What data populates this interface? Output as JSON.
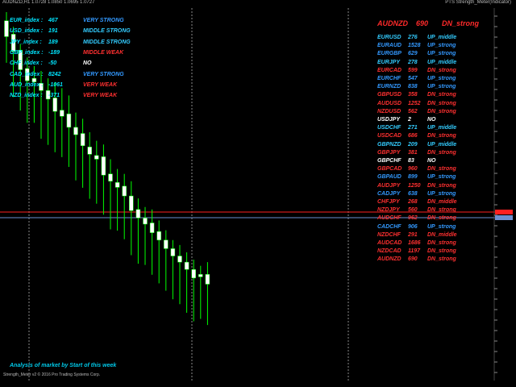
{
  "window": {
    "title": "AUDNZD,H1  1.0728 1.0850 1.0695 1.0727",
    "indicator_title": "PTS Strength_Meter(Indicator)"
  },
  "colors": {
    "bull": "#ffffff",
    "bear": "#ffffff",
    "wick": "#00ff00",
    "grid": "#666666",
    "strong_up": "#3399ff",
    "middle_up": "#33ccff",
    "weak": "#ff3030",
    "neutral": "#ffffff",
    "index_name": "#00e5ff",
    "price_line_red": "#ff2020",
    "price_line_blue": "#6d8fd0"
  },
  "indices": [
    {
      "name": "EUR_index :",
      "value": "467",
      "status": "VERY STRONG",
      "tone": "strong"
    },
    {
      "name": "USD_index :",
      "value": "191",
      "status": "MIDDLE STRONG",
      "tone": "middle"
    },
    {
      "name": "JPY_index :",
      "value": "189",
      "status": "MIDDLE STRONG",
      "tone": "middle"
    },
    {
      "name": "GBP_index :",
      "value": "-189",
      "status": "MIDDLE WEAK",
      "tone": "weak"
    },
    {
      "name": "CHF_index :",
      "value": "-50",
      "status": "NO",
      "tone": "neutral"
    },
    {
      "name": "CAD_index :",
      "value": "8242",
      "status": "VERY STRONG",
      "tone": "strong"
    },
    {
      "name": "AUD_index :",
      "value": "-1061",
      "status": "VERY WEAK",
      "tone": "weak"
    },
    {
      "name": "NZD_index :",
      "value": "-371",
      "status": "VERY WEAK",
      "tone": "weak"
    }
  ],
  "header_pair": {
    "symbol": "AUDNZD",
    "value": "690",
    "signal": "DN_strong"
  },
  "pairs": [
    {
      "symbol": "EURUSD",
      "value": "276",
      "signal": "UP_middle",
      "tone": "middle"
    },
    {
      "symbol": "EURAUD",
      "value": "1528",
      "signal": "UP_strong",
      "tone": "strong"
    },
    {
      "symbol": "EURGBP",
      "value": "629",
      "signal": "UP_strong",
      "tone": "strong"
    },
    {
      "symbol": "EURJPY",
      "value": "278",
      "signal": "UP_middle",
      "tone": "middle"
    },
    {
      "symbol": "EURCAD",
      "value": "599",
      "signal": "DN_strong",
      "tone": "weak"
    },
    {
      "symbol": "EURCHF",
      "value": "547",
      "signal": "UP_strong",
      "tone": "strong"
    },
    {
      "symbol": "EURNZD",
      "value": "838",
      "signal": "UP_strong",
      "tone": "strong"
    },
    {
      "symbol": "GBPUSD",
      "value": "358",
      "signal": "DN_strong",
      "tone": "weak"
    },
    {
      "symbol": "AUDUSD",
      "value": "1252",
      "signal": "DN_strong",
      "tone": "weak"
    },
    {
      "symbol": "NZDUSD",
      "value": "562",
      "signal": "DN_strong",
      "tone": "weak"
    },
    {
      "symbol": "USDJPY",
      "value": "2",
      "signal": "NO",
      "tone": "neutral"
    },
    {
      "symbol": "USDCHF",
      "value": "271",
      "signal": "UP_middle",
      "tone": "middle"
    },
    {
      "symbol": "USDCAD",
      "value": "686",
      "signal": "DN_strong",
      "tone": "weak"
    },
    {
      "symbol": "GBPNZD",
      "value": "209",
      "signal": "UP_middle",
      "tone": "middle"
    },
    {
      "symbol": "GBPJPY",
      "value": "381",
      "signal": "DN_strong",
      "tone": "weak"
    },
    {
      "symbol": "GBPCHF",
      "value": "83",
      "signal": "NO",
      "tone": "neutral"
    },
    {
      "symbol": "GBPCAD",
      "value": "960",
      "signal": "DN_strong",
      "tone": "weak"
    },
    {
      "symbol": "GBPAUD",
      "value": "899",
      "signal": "UP_strong",
      "tone": "strong"
    },
    {
      "symbol": "AUDJPY",
      "value": "1250",
      "signal": "DN_strong",
      "tone": "weak"
    },
    {
      "symbol": "CADJPY",
      "value": "638",
      "signal": "UP_strong",
      "tone": "strong"
    },
    {
      "symbol": "CHFJPY",
      "value": "268",
      "signal": "DN_middle",
      "tone": "weak"
    },
    {
      "symbol": "NZDJPY",
      "value": "560",
      "signal": "DN_strong",
      "tone": "weak"
    },
    {
      "symbol": "AUDCHF",
      "value": "962",
      "signal": "DN_strong",
      "tone": "weak"
    },
    {
      "symbol": "CADCHF",
      "value": "906",
      "signal": "UP_strong",
      "tone": "strong"
    },
    {
      "symbol": "NZDCHF",
      "value": "291",
      "signal": "DN_middle",
      "tone": "weak"
    },
    {
      "symbol": "AUDCAD",
      "value": "1686",
      "signal": "DN_strong",
      "tone": "weak"
    },
    {
      "symbol": "NZDCAD",
      "value": "1197",
      "signal": "DN_strong",
      "tone": "weak"
    },
    {
      "symbol": "AUDNZD",
      "value": "690",
      "signal": "DN_strong",
      "tone": "weak"
    }
  ],
  "footer": {
    "analysis_text": "Analysis of market by Start of this week",
    "copyright": "Strength_Meter v2 © 2016 Pro Trading Systems Corp."
  },
  "candles": [
    {
      "o": 0.9,
      "h": 0.2,
      "l": 1.7,
      "c": 2.2
    },
    {
      "o": 2.0,
      "h": 1.4,
      "l": 4.5,
      "c": 3.4
    },
    {
      "o": 3.3,
      "h": 2.8,
      "l": 5.6,
      "c": 4.9
    },
    {
      "o": 4.8,
      "h": 3.9,
      "l": 6.6,
      "c": 5.8
    },
    {
      "o": 5.6,
      "h": 4.6,
      "l": 6.6,
      "c": 5.9
    },
    {
      "o": 6.0,
      "h": 5.0,
      "l": 7.9,
      "c": 6.6
    },
    {
      "o": 6.6,
      "h": 5.6,
      "l": 8.4,
      "c": 7.3
    },
    {
      "o": 7.2,
      "h": 5.9,
      "l": 9.0,
      "c": 8.3
    },
    {
      "o": 8.2,
      "h": 6.4,
      "l": 9.4,
      "c": 8.7
    },
    {
      "o": 8.5,
      "h": 7.0,
      "l": 10.2,
      "c": 9.6
    },
    {
      "o": 9.6,
      "h": 8.4,
      "l": 11.3,
      "c": 10.2
    },
    {
      "o": 10.1,
      "h": 8.9,
      "l": 11.9,
      "c": 11.1
    },
    {
      "o": 11.2,
      "h": 10.0,
      "l": 12.8,
      "c": 11.8
    },
    {
      "o": 11.9,
      "h": 10.7,
      "l": 13.2,
      "c": 12.2
    },
    {
      "o": 12.0,
      "h": 11.0,
      "l": 14.1,
      "c": 13.5
    },
    {
      "o": 13.4,
      "h": 12.2,
      "l": 15.3,
      "c": 14.0
    },
    {
      "o": 14.1,
      "h": 13.0,
      "l": 15.4,
      "c": 14.5
    },
    {
      "o": 14.4,
      "h": 13.4,
      "l": 16.1,
      "c": 15.2
    },
    {
      "o": 15.2,
      "h": 14.0,
      "l": 17.4,
      "c": 16.4
    },
    {
      "o": 16.3,
      "h": 15.4,
      "l": 18.1,
      "c": 17.0
    },
    {
      "o": 17.0,
      "h": 16.1,
      "l": 18.2,
      "c": 17.5
    },
    {
      "o": 17.4,
      "h": 16.3,
      "l": 19.0,
      "c": 18.2
    },
    {
      "o": 18.1,
      "h": 17.2,
      "l": 19.7,
      "c": 18.8
    },
    {
      "o": 18.8,
      "h": 18.0,
      "l": 20.3,
      "c": 19.5
    },
    {
      "o": 19.5,
      "h": 18.8,
      "l": 21.0,
      "c": 20.1
    },
    {
      "o": 20.1,
      "h": 19.2,
      "l": 21.4,
      "c": 20.6
    },
    {
      "o": 20.6,
      "h": 19.8,
      "l": 22.1,
      "c": 21.2
    },
    {
      "o": 21.2,
      "h": 20.4,
      "l": 22.8,
      "c": 21.9
    },
    {
      "o": 21.8,
      "h": 20.9,
      "l": 22.6,
      "c": 21.6
    },
    {
      "o": 21.6,
      "h": 20.6,
      "l": 23.1,
      "c": 22.4
    }
  ]
}
